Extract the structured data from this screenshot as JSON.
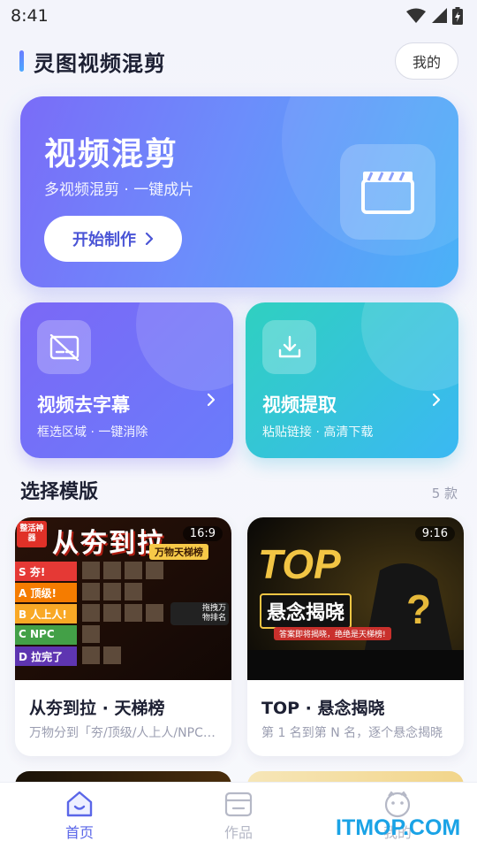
{
  "status_bar": {
    "time": "8:41"
  },
  "header": {
    "title": "灵图视频混剪",
    "mine_label": "我的"
  },
  "hero": {
    "title": "视频混剪",
    "subtitle": "多视频混剪 · 一键成片",
    "button_label": "开始制作",
    "icon": "clapperboard-icon"
  },
  "cards": [
    {
      "title": "视频去字幕",
      "subtitle": "框选区域 · 一键消除",
      "icon": "subtitle-off-icon"
    },
    {
      "title": "视频提取",
      "subtitle": "粘贴链接 · 高清下载",
      "icon": "download-icon"
    }
  ],
  "section": {
    "title": "选择模版",
    "count": "5 款"
  },
  "templates": [
    {
      "ratio": "16:9",
      "title": "从夯到拉 · 天梯榜",
      "description": "万物分到「夯/顶级/人上人/NPC/拉完了」",
      "thumb": {
        "headline": "从夯到拉",
        "subline": "万物天梯榜",
        "badge": "整活神器",
        "tiers": [
          "S 夯!",
          "A 顶级!",
          "B 人上人!",
          "C NPC",
          "D 拉完了"
        ],
        "side_note": "拖拽万物排名"
      }
    },
    {
      "ratio": "9:16",
      "title": "TOP · 悬念揭晓",
      "description": "第 1 名到第 N 名，逐个悬念揭晓",
      "thumb": {
        "headline": "TOP",
        "subline": "悬念揭晓",
        "caption": "答案即将揭晓，绝绝是天梯榜!"
      }
    }
  ],
  "tabbar": {
    "items": [
      {
        "label": "首页",
        "icon": "home-icon",
        "active": true
      },
      {
        "label": "作品",
        "icon": "folder-icon",
        "active": false
      },
      {
        "label": "我的",
        "icon": "profile-icon",
        "active": false
      }
    ]
  },
  "watermark": "ITMOP.COM",
  "colors": {
    "accent": "#5a66e8",
    "hero_start": "#7a6cf8",
    "hero_end": "#4ab2f7",
    "teal": "#2fd0c0"
  }
}
